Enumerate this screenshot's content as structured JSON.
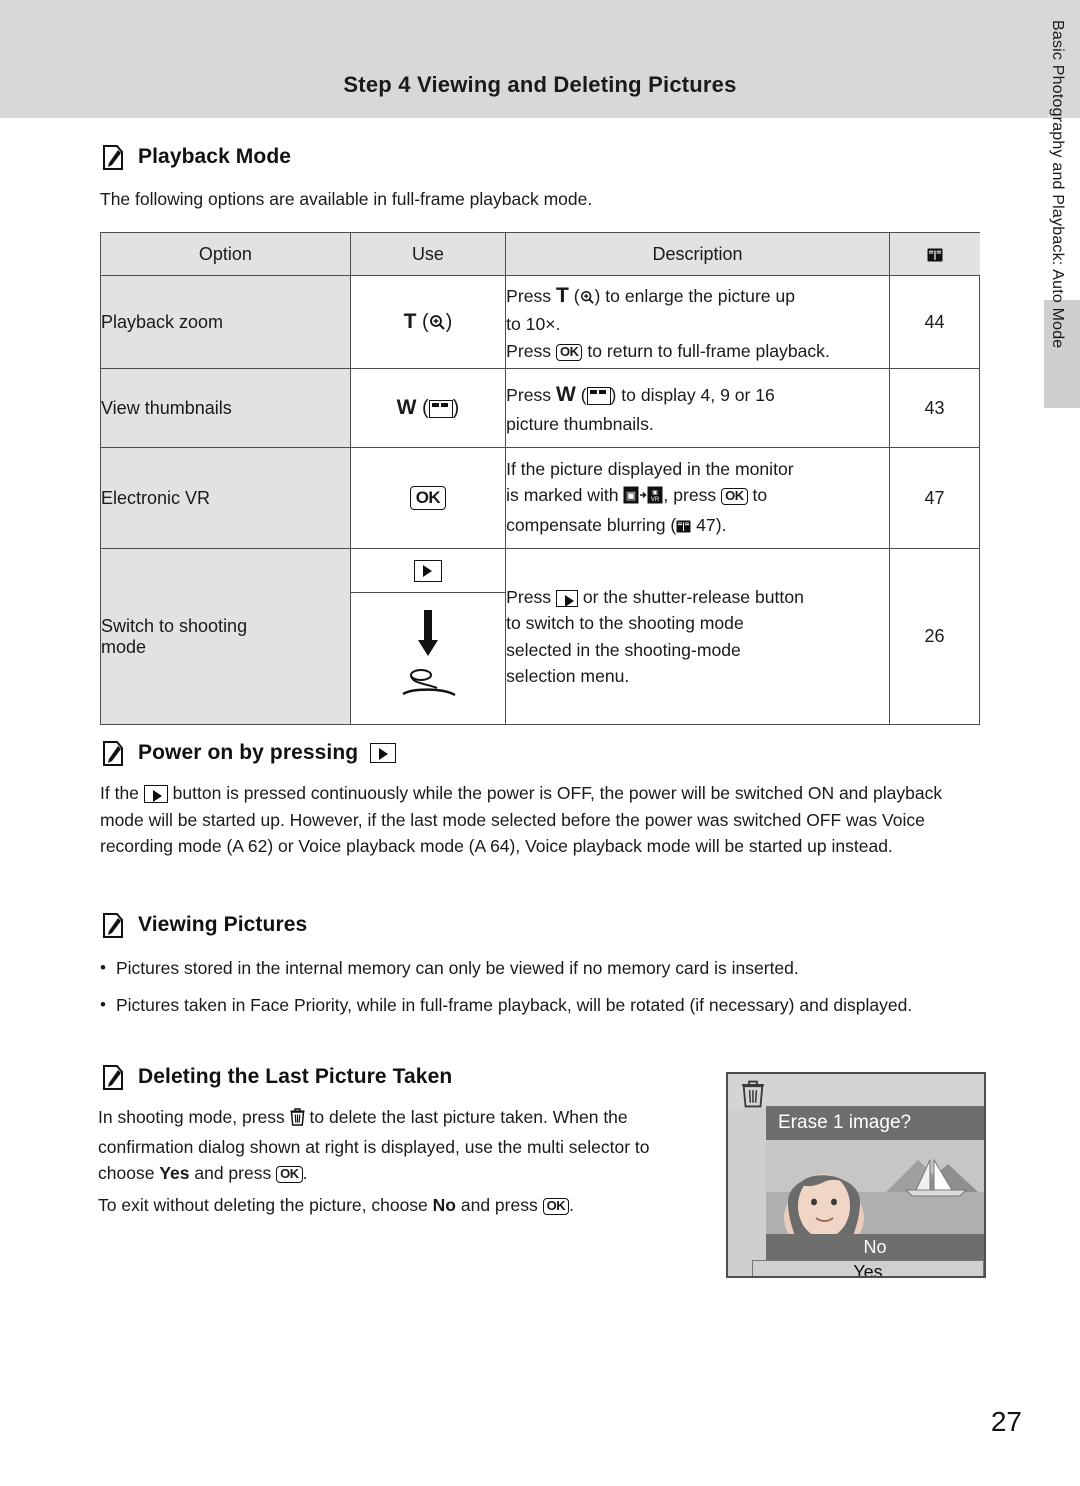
{
  "header": {
    "step": "Step 4",
    "title": "Viewing and Deleting Pictures"
  },
  "side_tab_text": "Basic Photography and Playback: Auto Mode",
  "sections": {
    "playback_mode": {
      "icon": "pencil-icon",
      "title": "Playback Mode",
      "intro": "The following options are available in full-frame playback mode."
    },
    "power_on": {
      "icon": "pencil-icon",
      "title_prefix": "Power on by pressing",
      "body": "button is pressed continuously while the power is OFF, the power will be switched ON and playback mode will be started up. However, if the last mode selected before the power was switched OFF was Voice recording mode (A 62) or Voice playback mode (A 64), Voice playback mode will be started up instead.",
      "body_lead": "If the"
    },
    "viewing_pictures": {
      "icon": "pencil-icon",
      "title": "Viewing Pictures",
      "bullets": [
        "Pictures stored in the internal memory can only be viewed if no memory card is inserted.",
        "Pictures taken in Face Priority, while in full-frame playback, will be rotated (if necessary) and displayed."
      ]
    },
    "deleting": {
      "icon": "pencil-icon",
      "title": "Deleting the Last Picture Taken",
      "p1": "In shooting mode, press",
      "p1b": "to delete the last picture taken. When the confirmation dialog shown at right is displayed, use the multi selector to choose",
      "p1c": "Yes",
      "p1d": "and press",
      "p1e": ".",
      "p2a": "To exit without deleting the picture, choose",
      "p2b": "No",
      "p2c": "and press",
      "p2d": "."
    }
  },
  "table": {
    "headers": {
      "option": "Option",
      "use": "Use",
      "description": "Description",
      "page": "book-icon"
    },
    "rows": [
      {
        "option": "Playback zoom",
        "use_label": "T",
        "use_sub": "(magnify-icon)",
        "desc_lines": [
          "Press T (magnify-icon) to enlarge the picture up to 10×.",
          "Press OK to return to full-frame playback."
        ],
        "desc_l1a": "Press",
        "desc_l1b": "T",
        "desc_l1c": ") to enlarge the picture up",
        "desc_l2": "to 10×.",
        "desc_l3a": "Press",
        "desc_l3b": "to return to full-frame playback.",
        "page": "44"
      },
      {
        "option": "View thumbnails",
        "use_label": "W",
        "use_sub": "(thumbnail-icon)",
        "desc_l1a": "Press",
        "desc_l1b": "W",
        "desc_l1c": ") to display 4, 9 or 16",
        "desc_l2": "picture thumbnails.",
        "page": "43"
      },
      {
        "option": "Electronic VR",
        "use_label": "OK",
        "desc_l1": "If the picture displayed in the monitor",
        "desc_l2a": "is marked with",
        "desc_l2b": ", press",
        "desc_l2c": "to",
        "desc_l3a": "compensate blurring (A 47).",
        "page": "47"
      },
      {
        "option_line1": "Switch to shooting",
        "option_line2": "mode",
        "use_icon_top": "playback-button-icon",
        "use_icon_arrow": "down-arrow-icon",
        "use_icon_bottom": "shutter-button-icon",
        "desc_l1a": "Press",
        "desc_l1b": "or the shutter-release button",
        "desc_l2": "to switch to the shooting mode",
        "desc_l3": "selected in the shooting-mode",
        "desc_l4": "selection menu.",
        "page": "26"
      }
    ]
  },
  "lcd": {
    "banner": "Erase 1 image?",
    "no": "No",
    "yes": "Yes",
    "trash_icon": "trash-icon"
  },
  "page_number": "27",
  "colors": {
    "header_band": "#d8d8d8",
    "table_shade": "#e2e2e2",
    "border": "#4d4d4d",
    "lcd_bg": "#cfcfcf",
    "lcd_bar": "#6e6e6e"
  }
}
